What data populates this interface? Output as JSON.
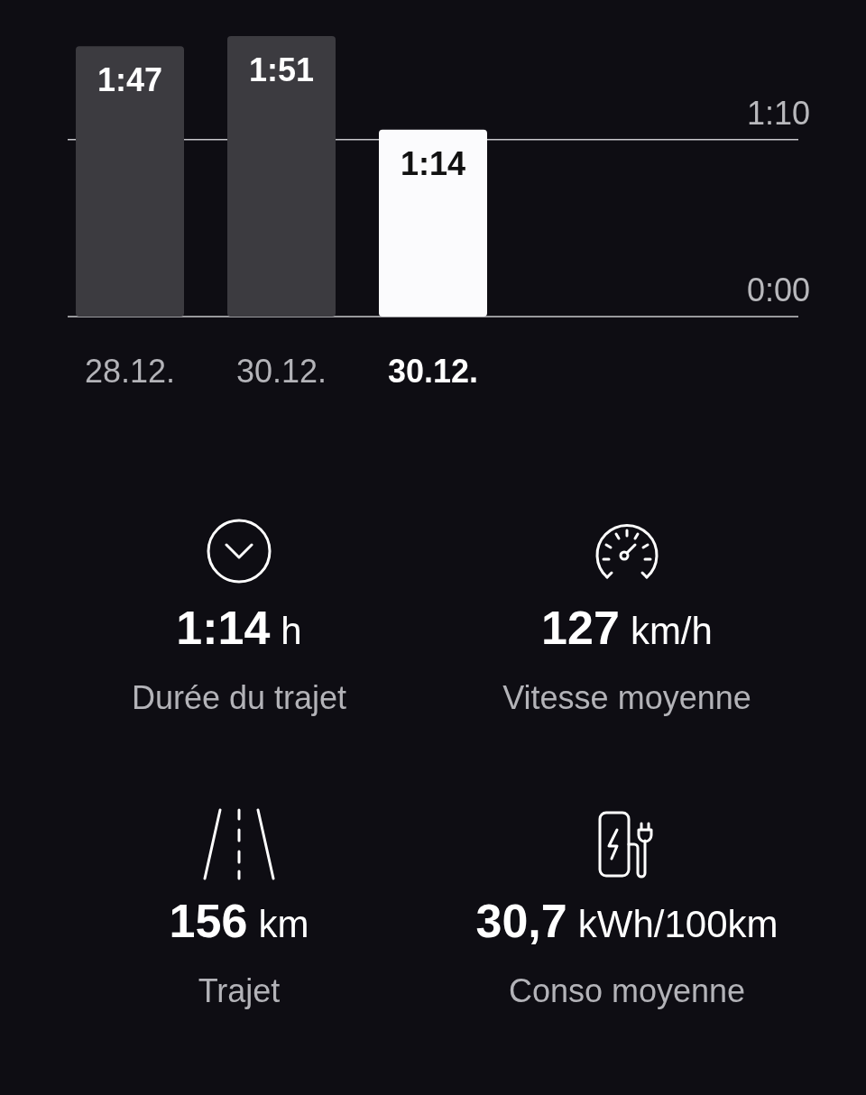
{
  "trip_chart": {
    "chart_data": {
      "type": "bar",
      "categories": [
        "28.12.",
        "30.12.",
        "30.12."
      ],
      "series": [
        {
          "color": "#3c3b40",
          "values": [
            107,
            111,
            null
          ]
        },
        {
          "color": "#fbfbfd",
          "values": [
            null,
            null,
            74
          ]
        }
      ],
      "stacked": true,
      "ylim": [
        0,
        111
      ],
      "yticks": [
        {
          "value": 0,
          "label": "0:00"
        },
        {
          "value": 70,
          "label": "1:10"
        }
      ],
      "value_labels": [
        "1:47",
        "1:51",
        "1:14"
      ]
    }
  },
  "stats": [
    {
      "kind": "duration",
      "value": "1:14",
      "unit": "h",
      "label": "Durée du trajet"
    },
    {
      "kind": "speed",
      "value": "127",
      "unit": "km/h",
      "label": "Vitesse moyenne"
    },
    {
      "kind": "distance",
      "value": "156",
      "unit": "km",
      "label": "Trajet"
    },
    {
      "kind": "consumption",
      "value": "30,7",
      "unit": "kWh/100km",
      "label": "Conso moyenne"
    }
  ]
}
